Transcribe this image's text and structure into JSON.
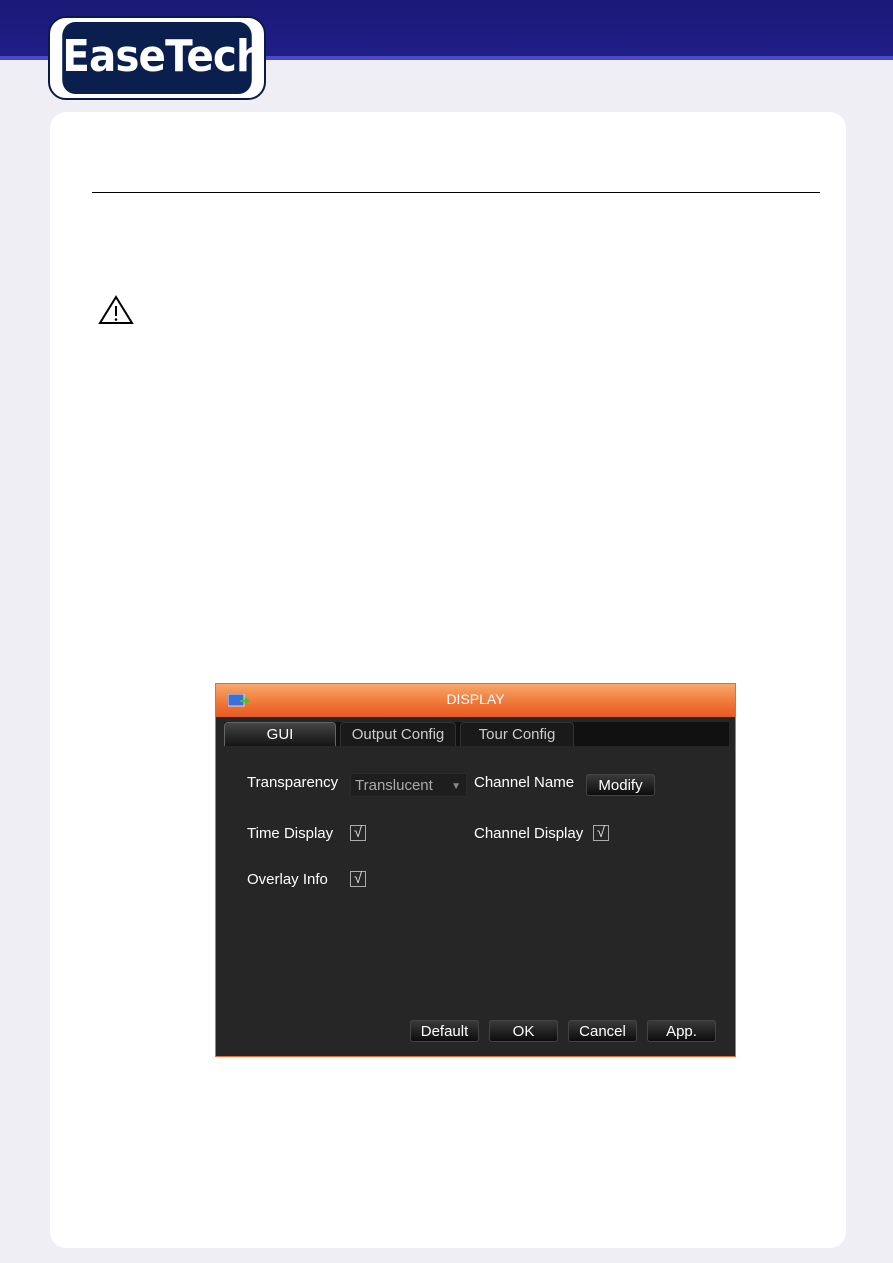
{
  "brand": {
    "logo_text": "EaseTech",
    "colors": {
      "banner": "#1e1e88",
      "accent": "#f07436"
    }
  },
  "warning_icon": "warning-triangle-icon",
  "dialog": {
    "title": "DISPLAY",
    "title_icon": "display-exit-icon",
    "tabs": [
      {
        "label": "GUI",
        "active": true
      },
      {
        "label": "Output Config",
        "active": false
      },
      {
        "label": "Tour Config",
        "active": false
      }
    ],
    "transparency": {
      "label": "Transparency",
      "value": "Translucent"
    },
    "channel_name": {
      "label": "Channel Name",
      "button": "Modify"
    },
    "time_display": {
      "label": "Time Display",
      "checked": true
    },
    "channel_display": {
      "label": "Channel Display",
      "checked": true
    },
    "overlay_info": {
      "label": "Overlay Info",
      "checked": true
    },
    "buttons": {
      "default": "Default",
      "ok": "OK",
      "cancel": "Cancel",
      "apply": "App."
    },
    "check_glyph": "√"
  }
}
